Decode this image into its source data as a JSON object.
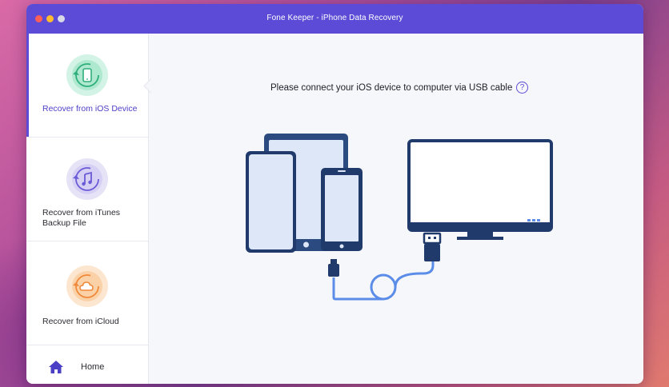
{
  "window": {
    "title": "Fone Keeper - iPhone Data Recovery"
  },
  "sidebar": {
    "items": [
      {
        "label": "Recover from iOS Device",
        "icon": "phone-restore-icon",
        "active": true
      },
      {
        "label": "Recover from iTunes Backup File",
        "icon": "music-restore-icon",
        "active": false
      },
      {
        "label": "Recover from iCloud",
        "icon": "cloud-restore-icon",
        "active": false
      }
    ],
    "home": {
      "label": "Home",
      "icon": "home-icon"
    }
  },
  "main": {
    "instruction": "Please connect your iOS device to computer via USB cable",
    "help": "?"
  },
  "colors": {
    "accent": "#5b4bd6",
    "device_stroke": "#1f3a6b",
    "cable": "#5b8de8"
  }
}
